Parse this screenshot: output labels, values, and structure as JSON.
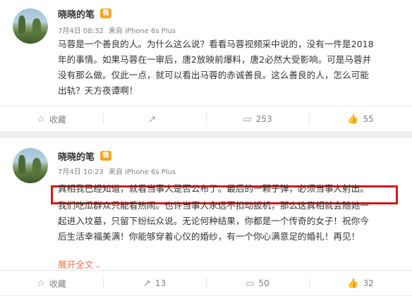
{
  "posts": [
    {
      "author": "晓晓的笔",
      "badge": "微",
      "time": "7月4日 08:32",
      "source": "来自 iPhone 6s Plus",
      "lines": [
        "马蓉是一个善良的人。为什么这么说？看看马蓉视频采中说的，没有一件是2018",
        "年的事情。如果马蓉在一审后，唐2放映前爆料，唐2必然大受影响。可是马蓉并",
        "没有那么做。仅此一点，就可以看出马蓉的赤诚善良。这么善良的人，怎么可能",
        "出轨？天方夜谭啊！"
      ],
      "actions": {
        "favorite": "收藏",
        "forward": "",
        "comment": "253",
        "like": "55"
      }
    },
    {
      "author": "晓晓的笔",
      "badge": "微",
      "time": "7月4日 10:23",
      "source": "来自 iPhone 6s Plus",
      "highlight": "真相我已经知道，就看当事人是否公布了。最后的一颗子弹，必须当事人射出。",
      "lines": [
        "我们吃瓜群众只能看热闹。也许当事人永远不扣动扳机，那么这真相就会随她一",
        "起进入坟墓，只留下纷纭众说。无论何种结果，你都是一个传奇的女子！祝你今",
        "后生活幸福美满！你能够穿着心仪的婚纱，有一个你心满意足的婚礼！再见！"
      ],
      "expand": "展开全文",
      "actions": {
        "favorite": "收藏",
        "forward": "13",
        "comment": "50",
        "like": "32"
      }
    }
  ],
  "icons": {
    "favorite": "star-icon",
    "forward": "forward-icon",
    "comment": "comment-icon",
    "like": "thumbs-up-icon"
  }
}
